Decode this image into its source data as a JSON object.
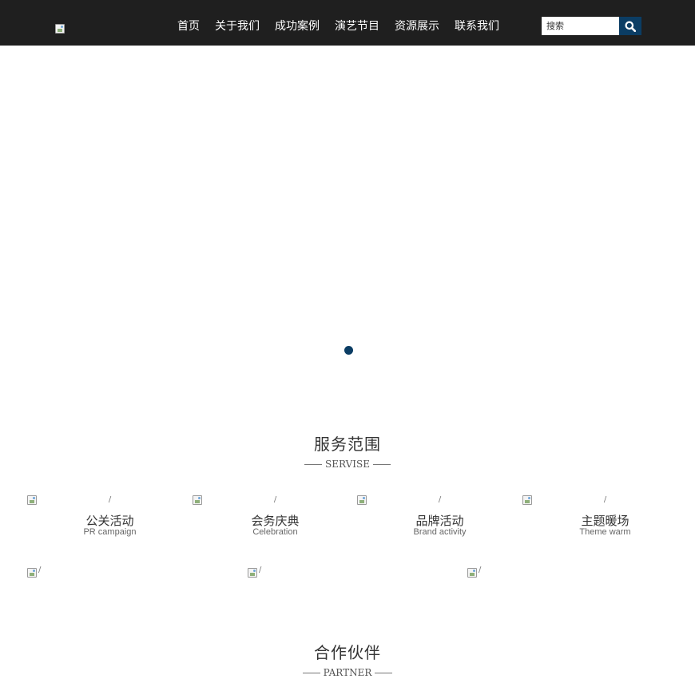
{
  "header": {
    "nav": [
      "首页",
      "关于我们",
      "成功案例",
      "演艺节目",
      "资源展示",
      "联系我们"
    ],
    "search_placeholder": "搜索",
    "search_icon": "search-icon",
    "colors": {
      "bar": "#1f1f1f",
      "accent": "#0b3d64"
    }
  },
  "banner": {
    "indicator_count": 1
  },
  "services": {
    "title": "服务范围",
    "subtitle": "SERVISE",
    "items": [
      {
        "name": "公关活动",
        "en": "PR campaign",
        "alt": "/"
      },
      {
        "name": "会务庆典",
        "en": "Celebration",
        "alt": "/"
      },
      {
        "name": "品牌活动",
        "en": "Brand activity",
        "alt": "/"
      },
      {
        "name": "主题暖场",
        "en": "Theme warm",
        "alt": "/"
      }
    ],
    "gallery_alt": [
      "/",
      "/",
      "/"
    ]
  },
  "partners": {
    "title": "合作伙伴",
    "subtitle": "PARTNER"
  }
}
